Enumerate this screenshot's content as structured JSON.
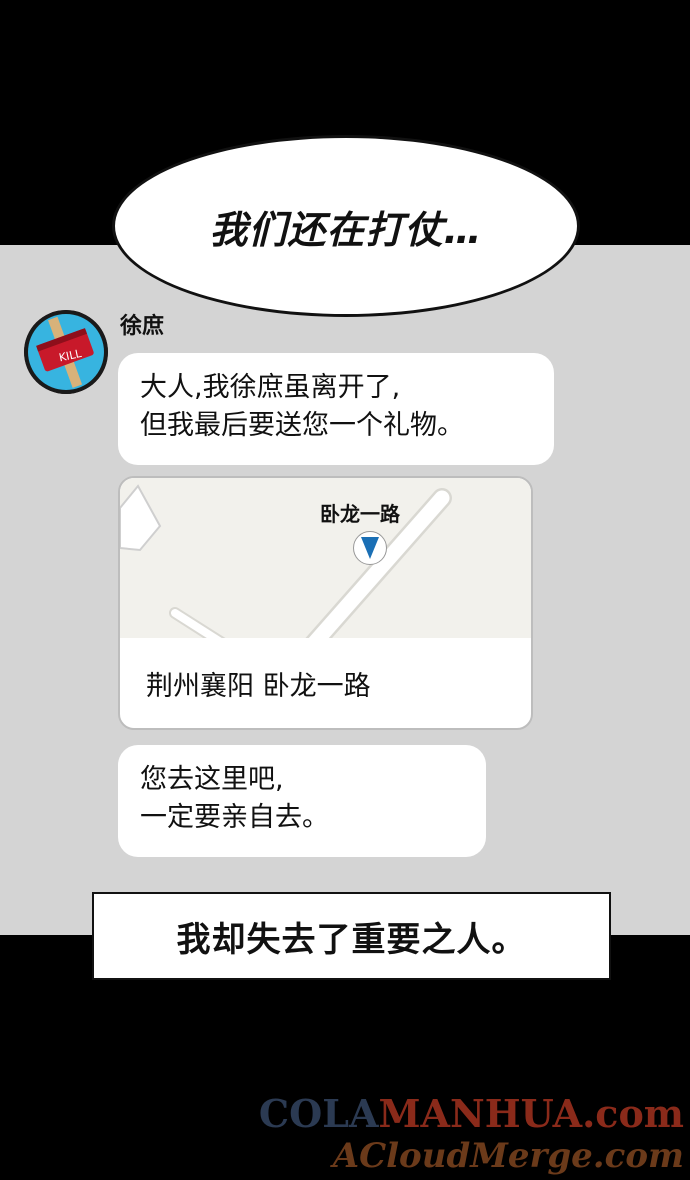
{
  "speech_bubble": {
    "text": "我们还在打仗…"
  },
  "chat": {
    "sender_name": "徐庶",
    "avatar": {
      "icon": "hammer-kill-icon",
      "label": "KILL"
    },
    "message1": {
      "line1": "大人,我徐庶虽离开了,",
      "line2": "但我最后要送您一个礼物。"
    },
    "location": {
      "road_label": "卧龙一路",
      "address": "荆州襄阳 卧龙一路",
      "pin_icon": "location-pin-icon"
    },
    "message2": {
      "line1": "您去这里吧,",
      "line2": "一定要亲自去。"
    }
  },
  "caption": {
    "text": "我却失去了重要之人。"
  },
  "watermark": {
    "line1_part1": "COLA",
    "line1_part2": "MANHUA",
    "line1_part3": ".com",
    "line2": "ACloudMerge.com"
  },
  "colors": {
    "chat_background": "#d4d4d4",
    "pin_arrow": "#1a6fb5",
    "avatar_ring": "#2aa6d6"
  }
}
